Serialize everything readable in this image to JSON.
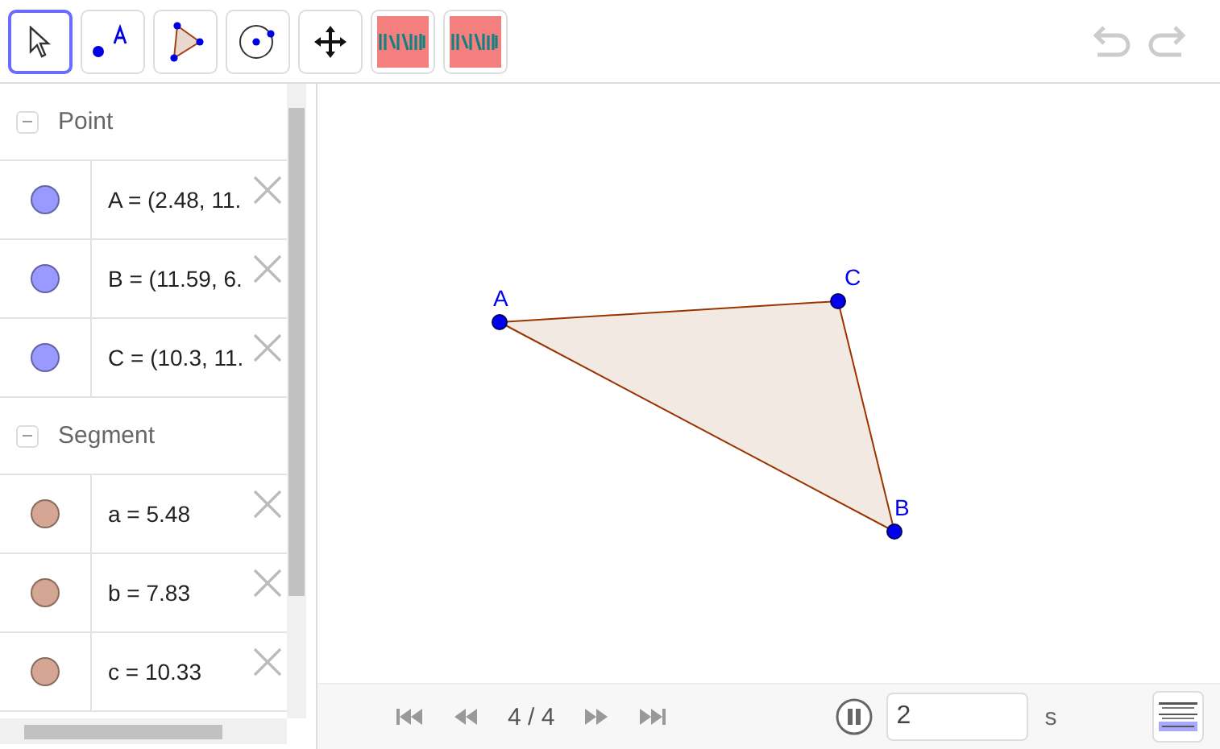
{
  "toolbar": {
    "tools": [
      {
        "kind": "move",
        "selected": true
      },
      {
        "kind": "point",
        "selected": false
      },
      {
        "kind": "polygon",
        "selected": false
      },
      {
        "kind": "circle",
        "selected": false
      },
      {
        "kind": "pan",
        "selected": false
      },
      {
        "kind": "custom",
        "selected": false
      },
      {
        "kind": "custom",
        "selected": false
      }
    ],
    "undo": {
      "disabled": true
    },
    "redo": {
      "disabled": true
    }
  },
  "algebra": {
    "sections": [
      {
        "title": "Point",
        "expanded": true,
        "items": [
          {
            "text": "A = (2.48, 11.",
            "color": "#9999ff"
          },
          {
            "text": "B = (11.59, 6.",
            "color": "#9999ff"
          },
          {
            "text": "C = (10.3, 11.",
            "color": "#9999ff"
          }
        ]
      },
      {
        "title": "Segment",
        "expanded": true,
        "items": [
          {
            "text": "a = 5.48",
            "color": "#d4a693"
          },
          {
            "text": "b = 7.83",
            "color": "#d4a693"
          },
          {
            "text": "c = 10.33",
            "color": "#d4a693"
          }
        ]
      }
    ]
  },
  "graphics": {
    "points": [
      {
        "label": "A"
      },
      {
        "label": "B"
      },
      {
        "label": "C"
      }
    ]
  },
  "playbar": {
    "step": "4 / 4",
    "playing": true,
    "speed": "2",
    "unit": "s"
  }
}
